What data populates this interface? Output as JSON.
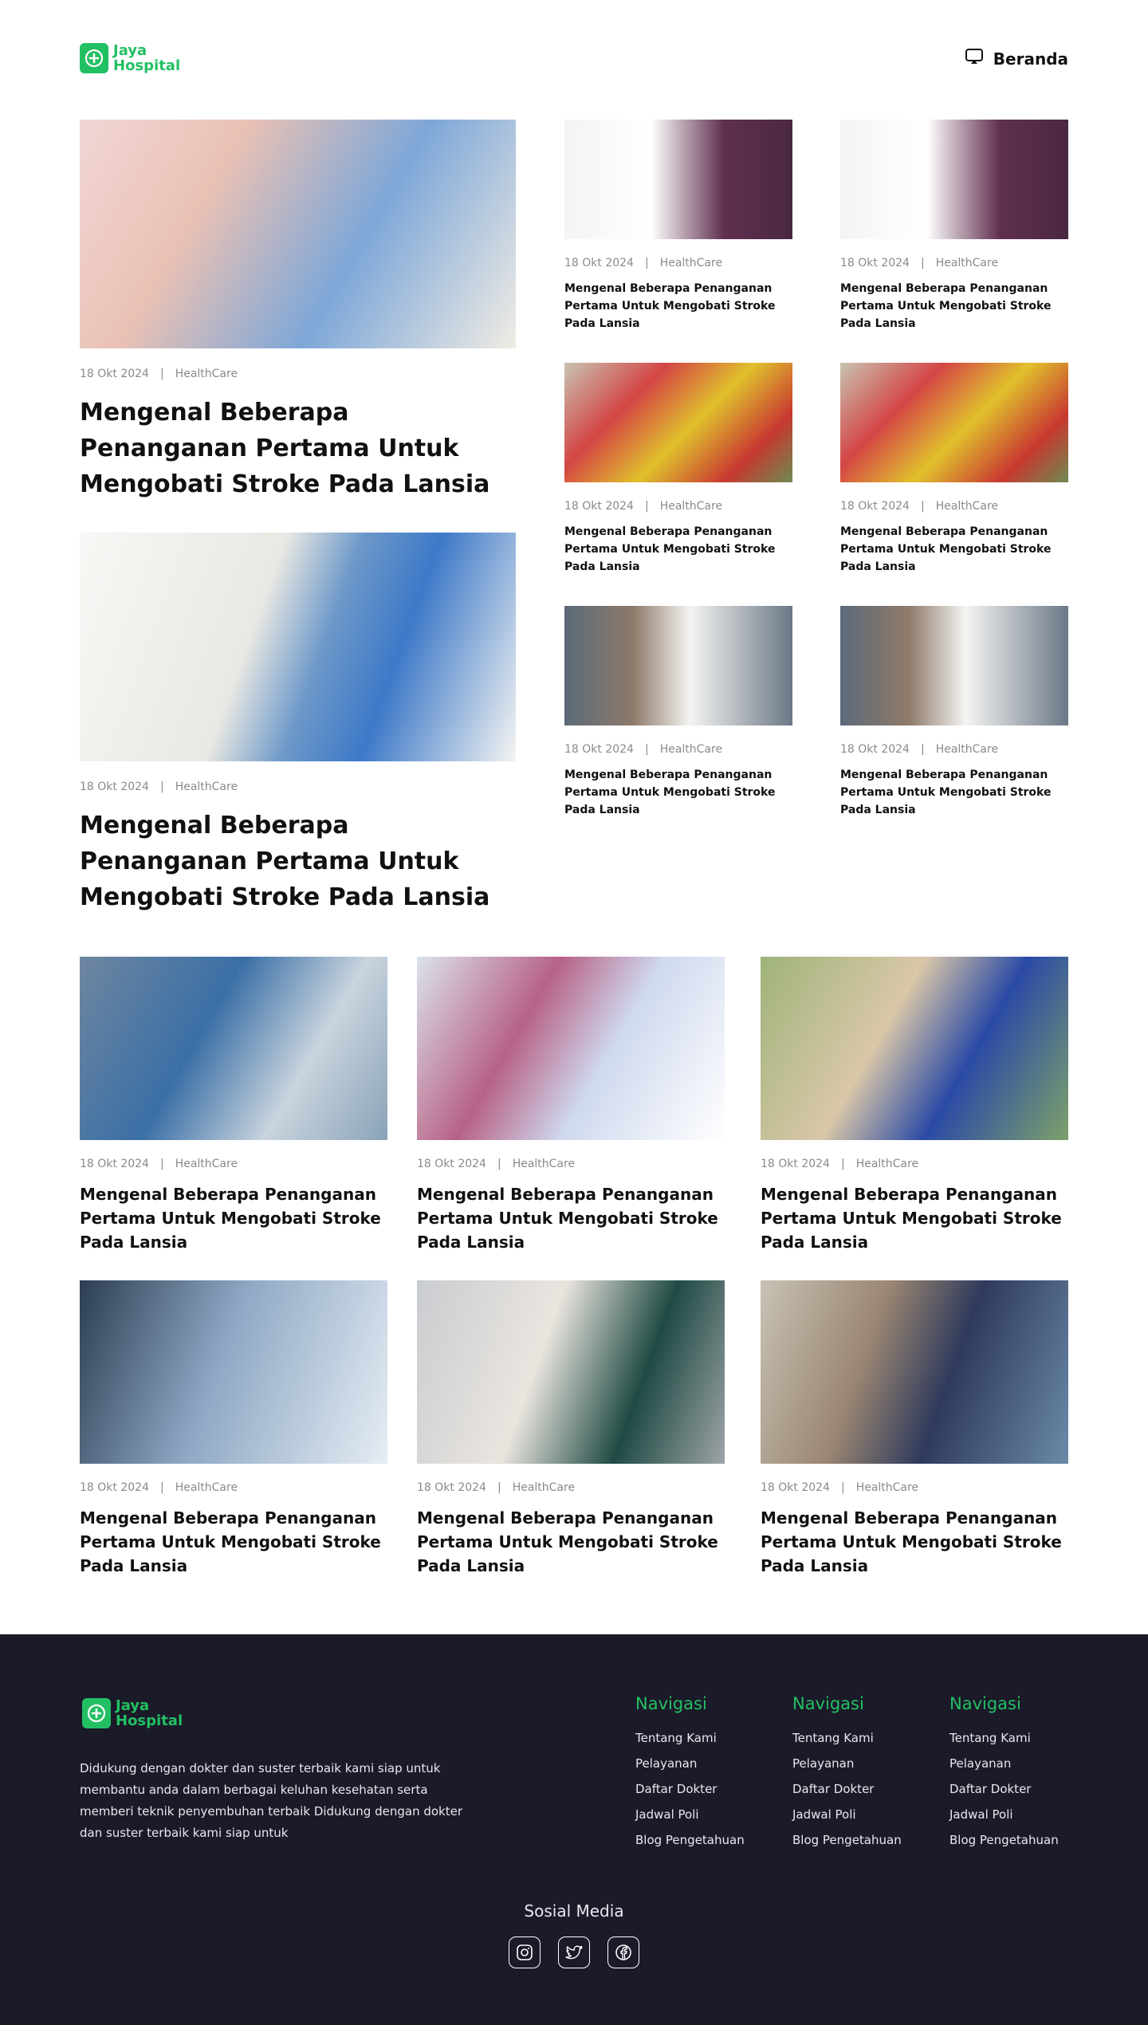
{
  "header": {
    "logo_line1": "Jaya",
    "logo_line2": "Hospital",
    "nav_home": "Beranda"
  },
  "featured": [
    {
      "date": "18 Okt 2024",
      "category": "HealthCare",
      "title": "Mengenal Beberapa Penanganan Pertama Untuk Mengobati Stroke Pada Lansia"
    },
    {
      "date": "18 Okt 2024",
      "category": "HealthCare",
      "title": "Mengenal Beberapa Penanganan Pertama Untuk Mengobati Stroke Pada Lansia"
    }
  ],
  "small_cards": [
    {
      "date": "18 Okt 2024",
      "category": "HealthCare",
      "title": "Mengenal Beberapa Penanganan Pertama Untuk Mengobati Stroke Pada Lansia"
    },
    {
      "date": "18 Okt 2024",
      "category": "HealthCare",
      "title": "Mengenal Beberapa Penanganan Pertama Untuk Mengobati Stroke Pada Lansia"
    },
    {
      "date": "18 Okt 2024",
      "category": "HealthCare",
      "title": "Mengenal Beberapa Penanganan Pertama Untuk Mengobati Stroke Pada Lansia"
    },
    {
      "date": "18 Okt 2024",
      "category": "HealthCare",
      "title": "Mengenal Beberapa Penanganan Pertama Untuk Mengobati Stroke Pada Lansia"
    },
    {
      "date": "18 Okt 2024",
      "category": "HealthCare",
      "title": "Mengenal Beberapa Penanganan Pertama Untuk Mengobati Stroke Pada Lansia"
    },
    {
      "date": "18 Okt 2024",
      "category": "HealthCare",
      "title": "Mengenal Beberapa Penanganan Pertama Untuk Mengobati Stroke Pada Lansia"
    }
  ],
  "grid_cards": [
    {
      "date": "18 Okt 2024",
      "category": "HealthCare",
      "title": "Mengenal Beberapa Penanganan Pertama Untuk Mengobati Stroke Pada Lansia"
    },
    {
      "date": "18 Okt 2024",
      "category": "HealthCare",
      "title": "Mengenal Beberapa Penanganan Pertama Untuk Mengobati Stroke Pada Lansia"
    },
    {
      "date": "18 Okt 2024",
      "category": "HealthCare",
      "title": "Mengenal Beberapa Penanganan Pertama Untuk Mengobati Stroke Pada Lansia"
    },
    {
      "date": "18 Okt 2024",
      "category": "HealthCare",
      "title": "Mengenal Beberapa Penanganan Pertama Untuk Mengobati Stroke Pada Lansia"
    },
    {
      "date": "18 Okt 2024",
      "category": "HealthCare",
      "title": "Mengenal Beberapa Penanganan Pertama Untuk Mengobati Stroke Pada Lansia"
    },
    {
      "date": "18 Okt 2024",
      "category": "HealthCare",
      "title": "Mengenal Beberapa Penanganan Pertama Untuk Mengobati Stroke Pada Lansia"
    }
  ],
  "footer": {
    "logo_line1": "Jaya",
    "logo_line2": "Hospital",
    "description": "Didukung dengan dokter dan suster terbaik kami siap untuk membantu anda dalam berbagai keluhan kesehatan serta memberi teknik penyembuhan terbaik Didukung dengan dokter dan suster terbaik kami siap untuk",
    "columns": [
      {
        "heading": "Navigasi",
        "links": [
          "Tentang Kami",
          "Pelayanan",
          "Daftar Dokter",
          "Jadwal Poli",
          "Blog Pengetahuan"
        ]
      },
      {
        "heading": "Navigasi",
        "links": [
          "Tentang Kami",
          "Pelayanan",
          "Daftar Dokter",
          "Jadwal Poli",
          "Blog Pengetahuan"
        ]
      },
      {
        "heading": "Navigasi",
        "links": [
          "Tentang Kami",
          "Pelayanan",
          "Daftar Dokter",
          "Jadwal Poli",
          "Blog Pengetahuan"
        ]
      }
    ],
    "social_heading": "Sosial Media",
    "social_icons": [
      "instagram-icon",
      "twitter-icon",
      "facebook-icon"
    ]
  },
  "colors": {
    "brand_green": "#22c063",
    "footer_bg": "#1b1a29",
    "meta_gray": "#8a8a8a"
  }
}
